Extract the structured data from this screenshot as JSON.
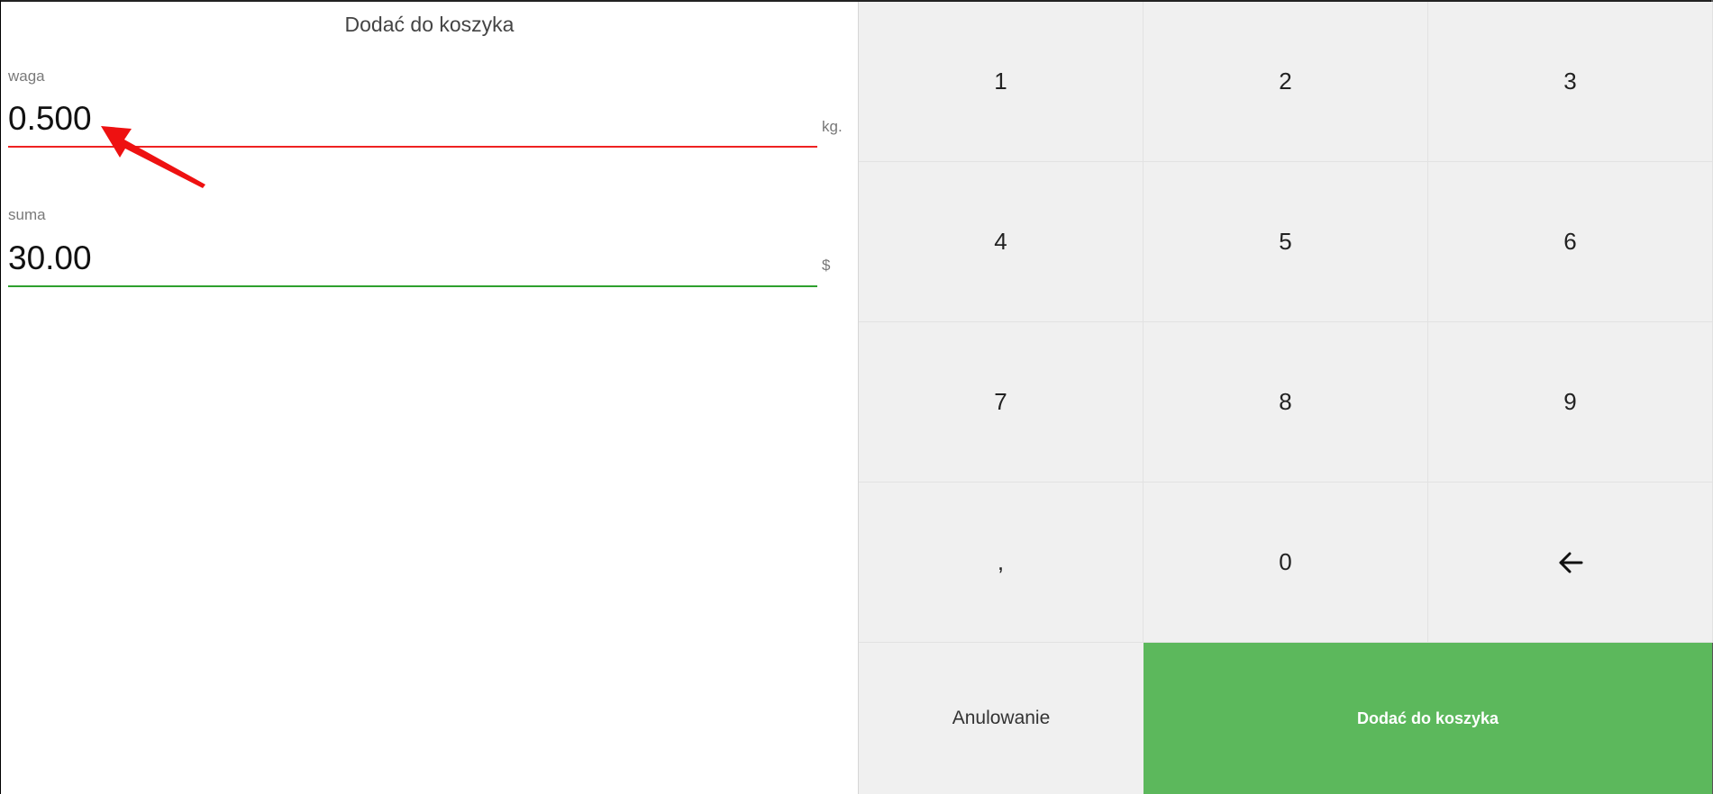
{
  "dialog": {
    "title": "Dodać do koszyka"
  },
  "fields": {
    "weight": {
      "label": "waga",
      "value": "0.500",
      "unit": "kg.",
      "underline_color": "#ee2222"
    },
    "sum": {
      "label": "suma",
      "value": "30.00",
      "unit": "$",
      "underline_color": "#2ea02e"
    }
  },
  "keypad": {
    "keys": [
      "1",
      "2",
      "3",
      "4",
      "5",
      "6",
      "7",
      "8",
      "9",
      ",",
      "0"
    ],
    "backspace_icon": "arrow-left-icon"
  },
  "actions": {
    "cancel_label": "Anulowanie",
    "submit_label": "Dodać do koszyka",
    "submit_color": "#5cb85c"
  },
  "annotation": {
    "icon": "red-arrow-annotation",
    "color": "#ee1111"
  }
}
